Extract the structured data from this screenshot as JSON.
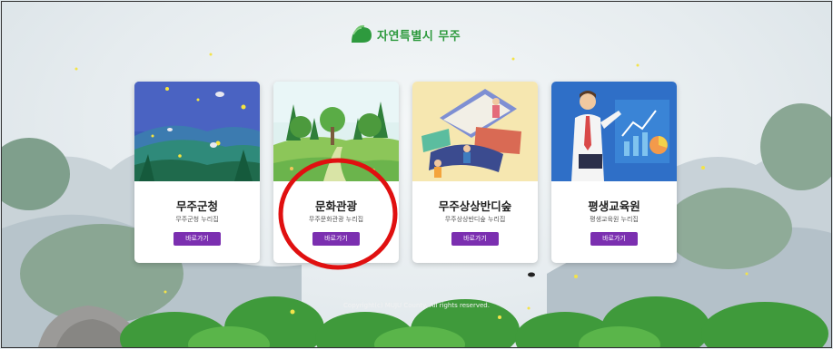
{
  "header": {
    "logo_text": "자연특별시 무주",
    "logo_icon": "mujuo-leaf-logo-icon"
  },
  "cards": [
    {
      "title": "무주군청",
      "subtitle": "무주군청 누리집",
      "button": "바로가기",
      "illustration": "fireflies-night-forest"
    },
    {
      "title": "문화관광",
      "subtitle": "무주문화관광 누리집",
      "button": "바로가기",
      "illustration": "park-trees-meadow"
    },
    {
      "title": "무주상상반디숲",
      "subtitle": "무주상상반디숲 누리집",
      "button": "바로가기",
      "illustration": "reading-kids-books"
    },
    {
      "title": "평생교육원",
      "subtitle": "평생교육원 누리집",
      "button": "바로가기",
      "illustration": "teacher-presentation"
    }
  ],
  "footer": {
    "copyright": "Copyright(c) MUJU County. All rights reserved."
  },
  "annotation": {
    "type": "red-circle",
    "target": "문화관광",
    "color": "#e01010"
  },
  "colors": {
    "button": "#7b2fb0",
    "logo": "#2e9a3e",
    "annotation": "#e01010"
  }
}
